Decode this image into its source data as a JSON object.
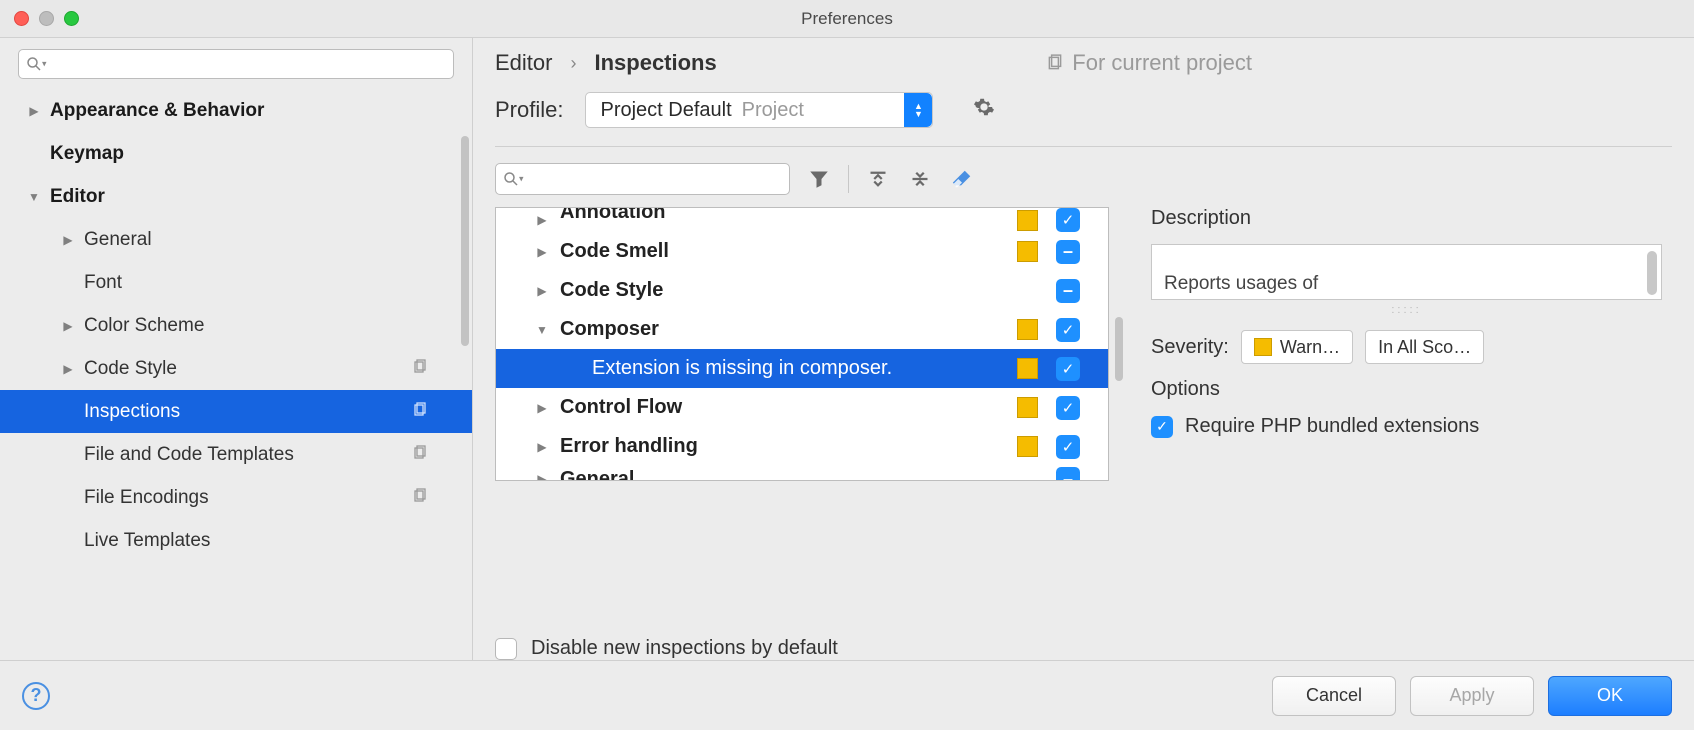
{
  "window": {
    "title": "Preferences"
  },
  "breadcrumb": {
    "items": [
      "Editor",
      "Inspections"
    ],
    "hint": "For current project"
  },
  "profile": {
    "label": "Profile:",
    "value": "Project Default",
    "scope": "Project"
  },
  "sidebar": {
    "items": [
      {
        "label": "Appearance & Behavior",
        "bold": true,
        "disclosure": "right"
      },
      {
        "label": "Keymap",
        "bold": true,
        "disclosure": "none"
      },
      {
        "label": "Editor",
        "bold": true,
        "disclosure": "down"
      },
      {
        "label": "General",
        "bold": false,
        "child": true,
        "disclosure": "right"
      },
      {
        "label": "Font",
        "bold": false,
        "child": true,
        "disclosure": "none"
      },
      {
        "label": "Color Scheme",
        "bold": false,
        "child": true,
        "disclosure": "right"
      },
      {
        "label": "Code Style",
        "bold": false,
        "child": true,
        "disclosure": "right",
        "proj": true
      },
      {
        "label": "Inspections",
        "bold": false,
        "child": true,
        "disclosure": "none",
        "selected": true,
        "proj": true
      },
      {
        "label": "File and Code Templates",
        "bold": false,
        "child": true,
        "disclosure": "none",
        "proj": true
      },
      {
        "label": "File Encodings",
        "bold": false,
        "child": true,
        "disclosure": "none",
        "proj": true
      },
      {
        "label": "Live Templates",
        "bold": false,
        "child": true,
        "disclosure": "none"
      }
    ]
  },
  "inspections": {
    "items": [
      {
        "label": "Annotation",
        "disclosure": "right",
        "warn": true,
        "check": "check",
        "cut": true
      },
      {
        "label": "Code Smell",
        "disclosure": "right",
        "warn": true,
        "check": "dash"
      },
      {
        "label": "Code Style",
        "disclosure": "right",
        "warn": false,
        "check": "dash"
      },
      {
        "label": "Composer",
        "disclosure": "down",
        "warn": true,
        "check": "check"
      },
      {
        "label": "Extension is missing in composer.",
        "sub": true,
        "selected": true,
        "warn": true,
        "check": "check"
      },
      {
        "label": "Control Flow",
        "disclosure": "right",
        "warn": true,
        "check": "check"
      },
      {
        "label": "Error handling",
        "disclosure": "right",
        "warn": true,
        "check": "check"
      },
      {
        "label": "General",
        "disclosure": "right",
        "warn": false,
        "check": "dash",
        "cutb": true
      }
    ],
    "disable_label": "Disable new inspections by default"
  },
  "detail": {
    "desc_label": "Description",
    "desc_text": "Reports usages of",
    "severity_label": "Severity:",
    "severity_value": "Warn…",
    "scope_value": "In All Sco…",
    "options_label": "Options",
    "option_require": "Require PHP bundled extensions"
  },
  "footer": {
    "cancel": "Cancel",
    "apply": "Apply",
    "ok": "OK"
  }
}
